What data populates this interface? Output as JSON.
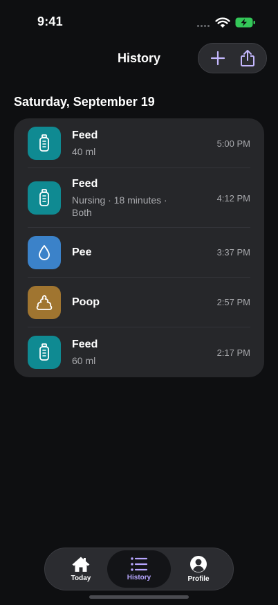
{
  "status": {
    "time": "9:41"
  },
  "header": {
    "title": "History",
    "add_icon": "plus-icon",
    "share_icon": "share-icon"
  },
  "section": {
    "date": "Saturday, September 19"
  },
  "entries": [
    {
      "title": "Feed",
      "subtitle": "40 ml",
      "time": "5:00 PM",
      "icon": "bottle-icon",
      "color": "#0f8a92"
    },
    {
      "title": "Feed",
      "subtitle": "Nursing · 18 minutes · Both",
      "time": "4:12 PM",
      "icon": "bottle-icon",
      "color": "#0f8a92"
    },
    {
      "title": "Pee",
      "subtitle": "",
      "time": "3:37 PM",
      "icon": "drop-icon",
      "color": "#3b82c9"
    },
    {
      "title": "Poop",
      "subtitle": "",
      "time": "2:57 PM",
      "icon": "poop-icon",
      "color": "#a07530"
    },
    {
      "title": "Feed",
      "subtitle": "60 ml",
      "time": "2:17 PM",
      "icon": "bottle-icon",
      "color": "#0f8a92"
    }
  ],
  "tabs": [
    {
      "label": "Today",
      "icon": "house-icon"
    },
    {
      "label": "History",
      "icon": "list-icon"
    },
    {
      "label": "Profile",
      "icon": "person-icon"
    }
  ],
  "colors": {
    "accent": "#b7a6ff",
    "battery": "#34c759"
  }
}
